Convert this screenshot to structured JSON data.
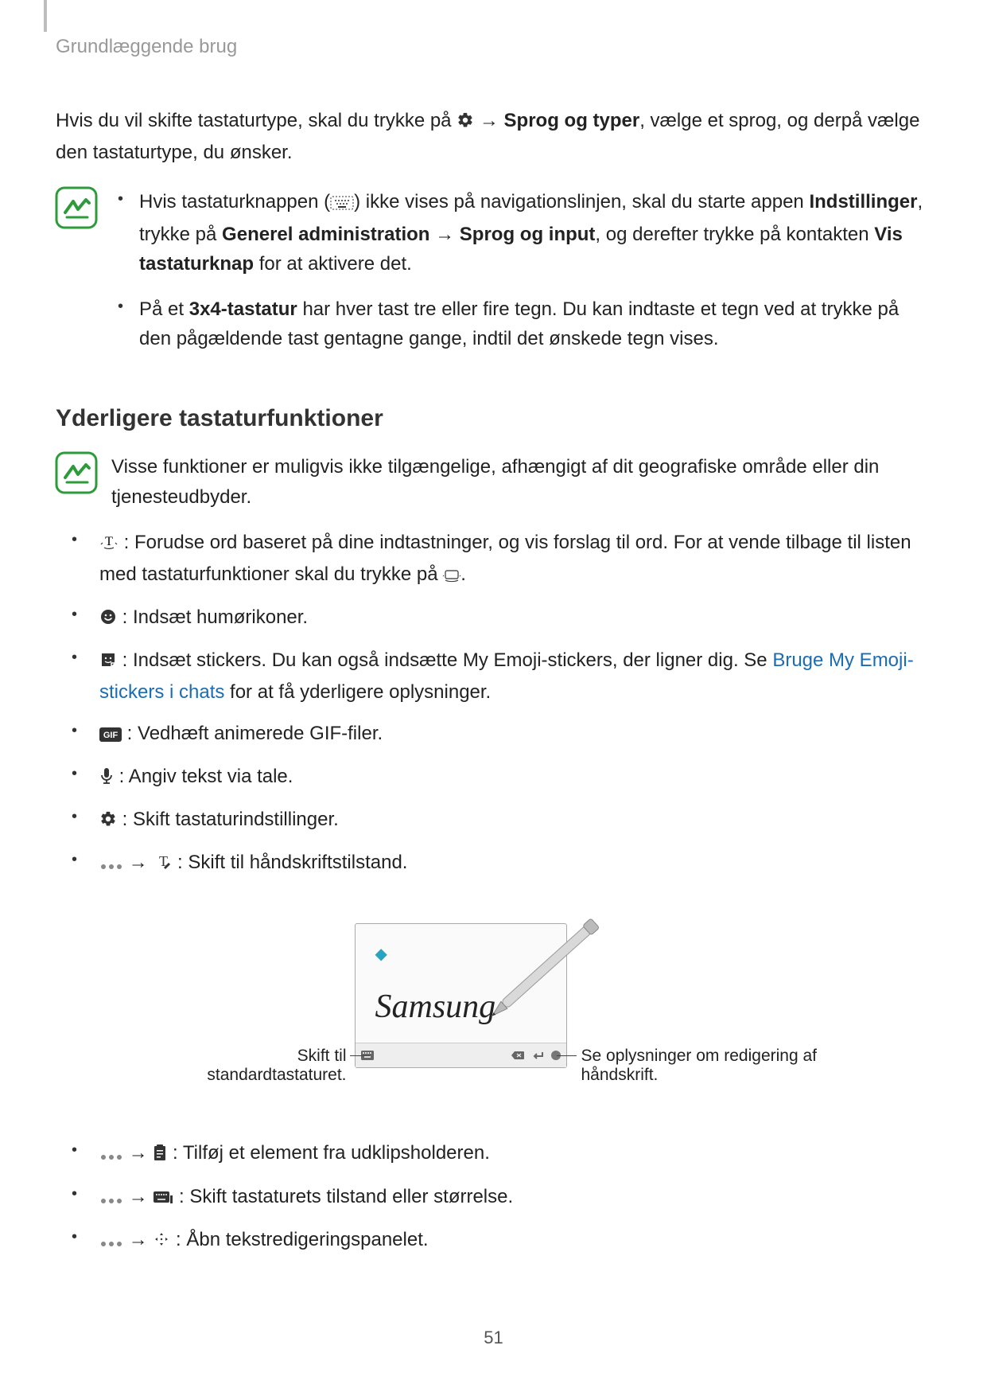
{
  "header": {
    "breadcrumb": "Grundlæggende brug"
  },
  "intro": {
    "part1": "Hvis du vil skifte tastaturtype, skal du trykke på ",
    "arrow": "→",
    "bold1": "Sprog og typer",
    "part2": ", vælge et sprog, og derpå vælge den tastaturtype, du ønsker."
  },
  "note1": {
    "items": [
      {
        "p1": "Hvis tastaturknappen (",
        "p2": ") ikke vises på navigationslinjen, skal du starte appen ",
        "b1": "Indstillinger",
        "p3": ", trykke på ",
        "b2": "Generel administration",
        "arrow": "→",
        "b3": "Sprog og input",
        "p4": ", og derefter trykke på kontakten ",
        "b4": "Vis tastaturknap",
        "p5": " for at aktivere det."
      },
      {
        "p1": "På et ",
        "b1": "3x4-tastatur",
        "p2": " har hver tast tre eller fire tegn. Du kan indtaste et tegn ved at trykke på den pågældende tast gentagne gange, indtil det ønskede tegn vises."
      }
    ]
  },
  "section_heading": "Yderligere tastaturfunktioner",
  "note2": {
    "text": "Visse funktioner er muligvis ikke tilgængelige, afhængigt af dit geografiske område eller din tjenesteudbyder."
  },
  "features": [
    {
      "pre": "",
      "text1": " : Forudse ord baseret på dine indtastninger, og vis forslag til ord. For at vende tilbage til listen med tastaturfunktioner skal du trykke på ",
      "text2": "."
    },
    {
      "text": " : Indsæt humørikoner."
    },
    {
      "text1": " : Indsæt stickers. Du kan også indsætte My Emoji-stickers, der ligner dig. Se ",
      "link": "Bruge My Emoji-stickers i chats",
      "text2": " for at få yderligere oplysninger."
    },
    {
      "text": " : Vedhæft animerede GIF-filer."
    },
    {
      "text": " : Angiv tekst via tale."
    },
    {
      "text": " : Skift tastaturindstillinger."
    },
    {
      "arrow": "→",
      "text": " : Skift til håndskriftstilstand."
    }
  ],
  "handwriting": {
    "script": "Samsung",
    "left_label": "Skift til standardtastaturet.",
    "right_label": "Se oplysninger om redigering af håndskrift."
  },
  "features2": [
    {
      "arrow": "→",
      "text": " : Tilføj et element fra udklipsholderen."
    },
    {
      "arrow": "→",
      "text": " : Skift tastaturets tilstand eller størrelse."
    },
    {
      "arrow": "→",
      "text": " : Åbn tekstredigeringspanelet."
    }
  ],
  "page_number": "51"
}
